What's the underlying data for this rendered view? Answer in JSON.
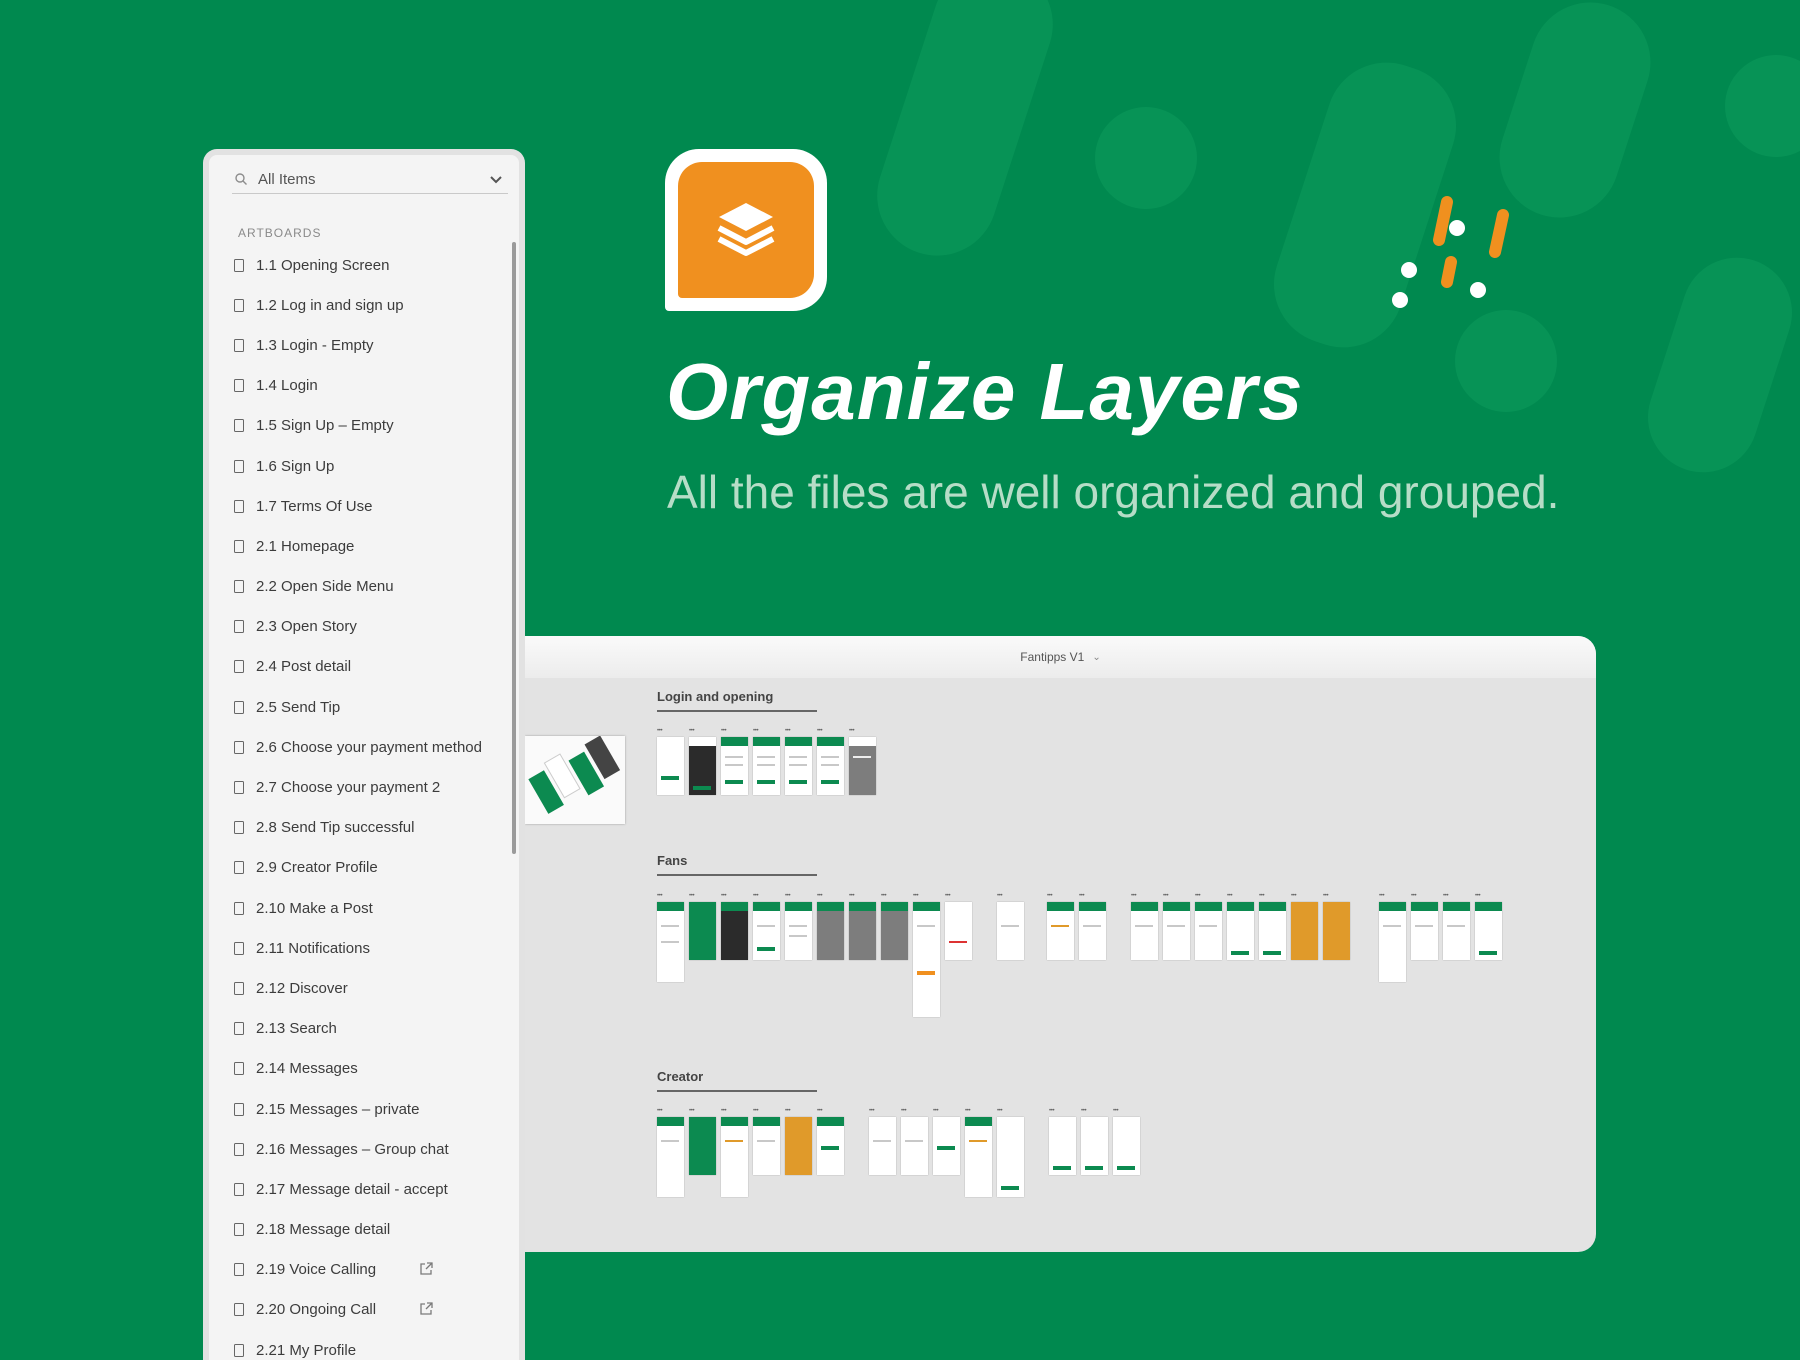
{
  "panel": {
    "search_label": "All Items",
    "section_label": "ARTBOARDS",
    "items": [
      {
        "label": "1.1 Opening Screen",
        "external": false
      },
      {
        "label": "1.2 Log in and sign up",
        "external": false
      },
      {
        "label": "1.3 Login - Empty",
        "external": false
      },
      {
        "label": "1.4 Login",
        "external": false
      },
      {
        "label": "1.5 Sign Up – Empty",
        "external": false
      },
      {
        "label": "1.6 Sign Up",
        "external": false
      },
      {
        "label": "1.7 Terms Of Use",
        "external": false
      },
      {
        "label": "2.1 Homepage",
        "external": false
      },
      {
        "label": "2.2 Open Side Menu",
        "external": false
      },
      {
        "label": "2.3 Open Story",
        "external": false
      },
      {
        "label": "2.4 Post detail",
        "external": false
      },
      {
        "label": "2.5 Send Tip",
        "external": false
      },
      {
        "label": "2.6 Choose your payment method",
        "external": false
      },
      {
        "label": "2.7 Choose your payment 2",
        "external": false
      },
      {
        "label": "2.8 Send Tip successful",
        "external": false
      },
      {
        "label": "2.9 Creator Profile",
        "external": false
      },
      {
        "label": "2.10 Make a Post",
        "external": false
      },
      {
        "label": "2.11 Notifications",
        "external": false
      },
      {
        "label": "2.12 Discover",
        "external": false
      },
      {
        "label": "2.13 Search",
        "external": false
      },
      {
        "label": "2.14 Messages",
        "external": false
      },
      {
        "label": "2.15 Messages – private",
        "external": false
      },
      {
        "label": "2.16 Messages – Group chat",
        "external": false
      },
      {
        "label": "2.17 Message detail - accept",
        "external": false
      },
      {
        "label": "2.18 Message detail",
        "external": false
      },
      {
        "label": "2.19 Voice Calling",
        "external": true
      },
      {
        "label": "2.20 Ongoing Call",
        "external": true
      },
      {
        "label": "2.21 My Profile",
        "external": false
      }
    ]
  },
  "hero": {
    "title": "Organize Layers",
    "subtitle": "All the files are well organized and grouped."
  },
  "canvas": {
    "document_title": "Fantipps V1",
    "groups": [
      {
        "label": "Login and opening"
      },
      {
        "label": "Fans"
      },
      {
        "label": "Creator"
      }
    ]
  },
  "colors": {
    "background": "#00894f",
    "accent_orange": "#f0901f",
    "panel_bg": "#f4f4f4"
  },
  "icons": {
    "search": "search-icon",
    "dropdown": "chevron-down-icon",
    "artboard": "artboard-icon",
    "external_link": "external-link-icon",
    "app": "layers-stack-icon"
  }
}
